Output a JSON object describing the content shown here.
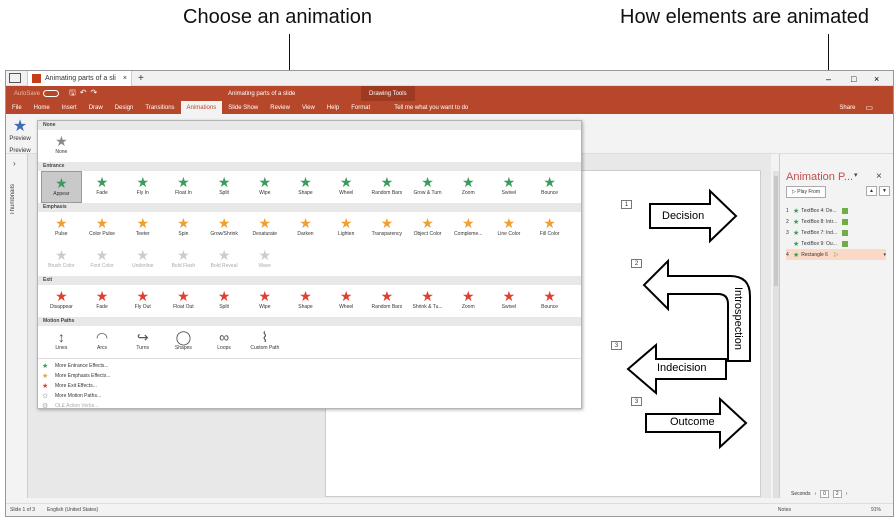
{
  "callouts": {
    "left": "Choose an animation",
    "right": "How elements are animated"
  },
  "tabbar": {
    "tab_title": "Animating parts of a sli",
    "close": "×",
    "new_tab": "+"
  },
  "window_controls": {
    "min": "–",
    "max": "□",
    "close": "×"
  },
  "titlebar": {
    "autosave": "AutoSave",
    "doc_title": "Animating parts of a slide",
    "drawing_tools": "Drawing Tools"
  },
  "ribbon_tabs": [
    "File",
    "Home",
    "Insert",
    "Draw",
    "Design",
    "Transitions",
    "Animations",
    "Slide Show",
    "Review",
    "View",
    "Help",
    "Format"
  ],
  "ribbon_active": "Animations",
  "tell_me": "Tell me what you want to do",
  "share": "Share",
  "preview": {
    "label": "Preview",
    "sub": "Preview"
  },
  "thumbnails": "Thumbnails",
  "gallery": {
    "none_header": "None",
    "none_item": "None",
    "sections": [
      {
        "header": "Entrance",
        "color": "#3a9b5c",
        "items": [
          {
            "label": "Appear",
            "sel": true
          },
          {
            "label": "Fade"
          },
          {
            "label": "Fly In"
          },
          {
            "label": "Float In"
          },
          {
            "label": "Split"
          },
          {
            "label": "Wipe"
          },
          {
            "label": "Shape"
          },
          {
            "label": "Wheel"
          },
          {
            "label": "Random Bars"
          },
          {
            "label": "Grow & Turn"
          },
          {
            "label": "Zoom"
          },
          {
            "label": "Swivel"
          },
          {
            "label": "Bounce"
          }
        ]
      },
      {
        "header": "Emphasis",
        "color": "#f0a030",
        "items": [
          {
            "label": "Pulse"
          },
          {
            "label": "Color Pulse"
          },
          {
            "label": "Teeter"
          },
          {
            "label": "Spin"
          },
          {
            "label": "Grow/Shrink"
          },
          {
            "label": "Desaturate"
          },
          {
            "label": "Darken"
          },
          {
            "label": "Lighten"
          },
          {
            "label": "Transparency"
          },
          {
            "label": "Object Color"
          },
          {
            "label": "Compleme..."
          },
          {
            "label": "Line Color"
          },
          {
            "label": "Fill Color"
          },
          {
            "label": "Brush Color",
            "dim": true
          },
          {
            "label": "Font Color",
            "dim": true
          },
          {
            "label": "Underline",
            "dim": true
          },
          {
            "label": "Bold Flash",
            "dim": true
          },
          {
            "label": "Bold Reveal",
            "dim": true
          },
          {
            "label": "Wave",
            "dim": true
          }
        ]
      },
      {
        "header": "Exit",
        "color": "#e04030",
        "items": [
          {
            "label": "Disappear"
          },
          {
            "label": "Fade"
          },
          {
            "label": "Fly Out"
          },
          {
            "label": "Float Out"
          },
          {
            "label": "Split"
          },
          {
            "label": "Wipe"
          },
          {
            "label": "Shape"
          },
          {
            "label": "Wheel"
          },
          {
            "label": "Random Bars"
          },
          {
            "label": "Shrink & Tu..."
          },
          {
            "label": "Zoom"
          },
          {
            "label": "Swivel"
          },
          {
            "label": "Bounce"
          }
        ]
      },
      {
        "header": "Motion Paths",
        "color": "#555555",
        "items": [
          {
            "label": "Lines"
          },
          {
            "label": "Arcs"
          },
          {
            "label": "Turns"
          },
          {
            "label": "Shapes"
          },
          {
            "label": "Loops"
          },
          {
            "label": "Custom Path"
          }
        ]
      }
    ],
    "more": [
      {
        "label": "More Entrance Effects...",
        "icon": "★",
        "color": "#3a9b5c"
      },
      {
        "label": "More Emphasis Effects...",
        "icon": "★",
        "color": "#f0a030"
      },
      {
        "label": "More Exit Effects...",
        "icon": "★",
        "color": "#e04030"
      },
      {
        "label": "More Motion Paths...",
        "icon": "☆",
        "color": "#555555"
      },
      {
        "label": "OLE Action Verbs...",
        "icon": "⚙",
        "color": "#aaaaaa",
        "dim": true
      }
    ]
  },
  "slide": {
    "nums": [
      "1",
      "2",
      "3",
      "3"
    ],
    "decision": "Decision",
    "introspection": "Introspection",
    "indecision": "Indecision",
    "outcome": "Outcome"
  },
  "anim_pane": {
    "title": "Animation P...",
    "play_from": "Play From",
    "up": "▲",
    "down": "▼",
    "items": [
      {
        "num": "1",
        "label": "TextBox 4: De..."
      },
      {
        "num": "2",
        "label": "TextBox 8: Intr..."
      },
      {
        "num": "3",
        "label": "TextBox 7: Ind..."
      },
      {
        "num": "",
        "label": "TextBox 9: Ou..."
      },
      {
        "num": "4",
        "label": "Rectangle 6",
        "sel": true
      }
    ],
    "seconds": "Seconds",
    "sec_start": "0",
    "sec_end": "2"
  },
  "status": {
    "slide": "Slide 1 of 3",
    "lang": "English (United States)",
    "notes": "Notes",
    "zoom": "91%"
  },
  "colors": {
    "accent": "#b7472a",
    "callout_red": "#c0504d"
  }
}
